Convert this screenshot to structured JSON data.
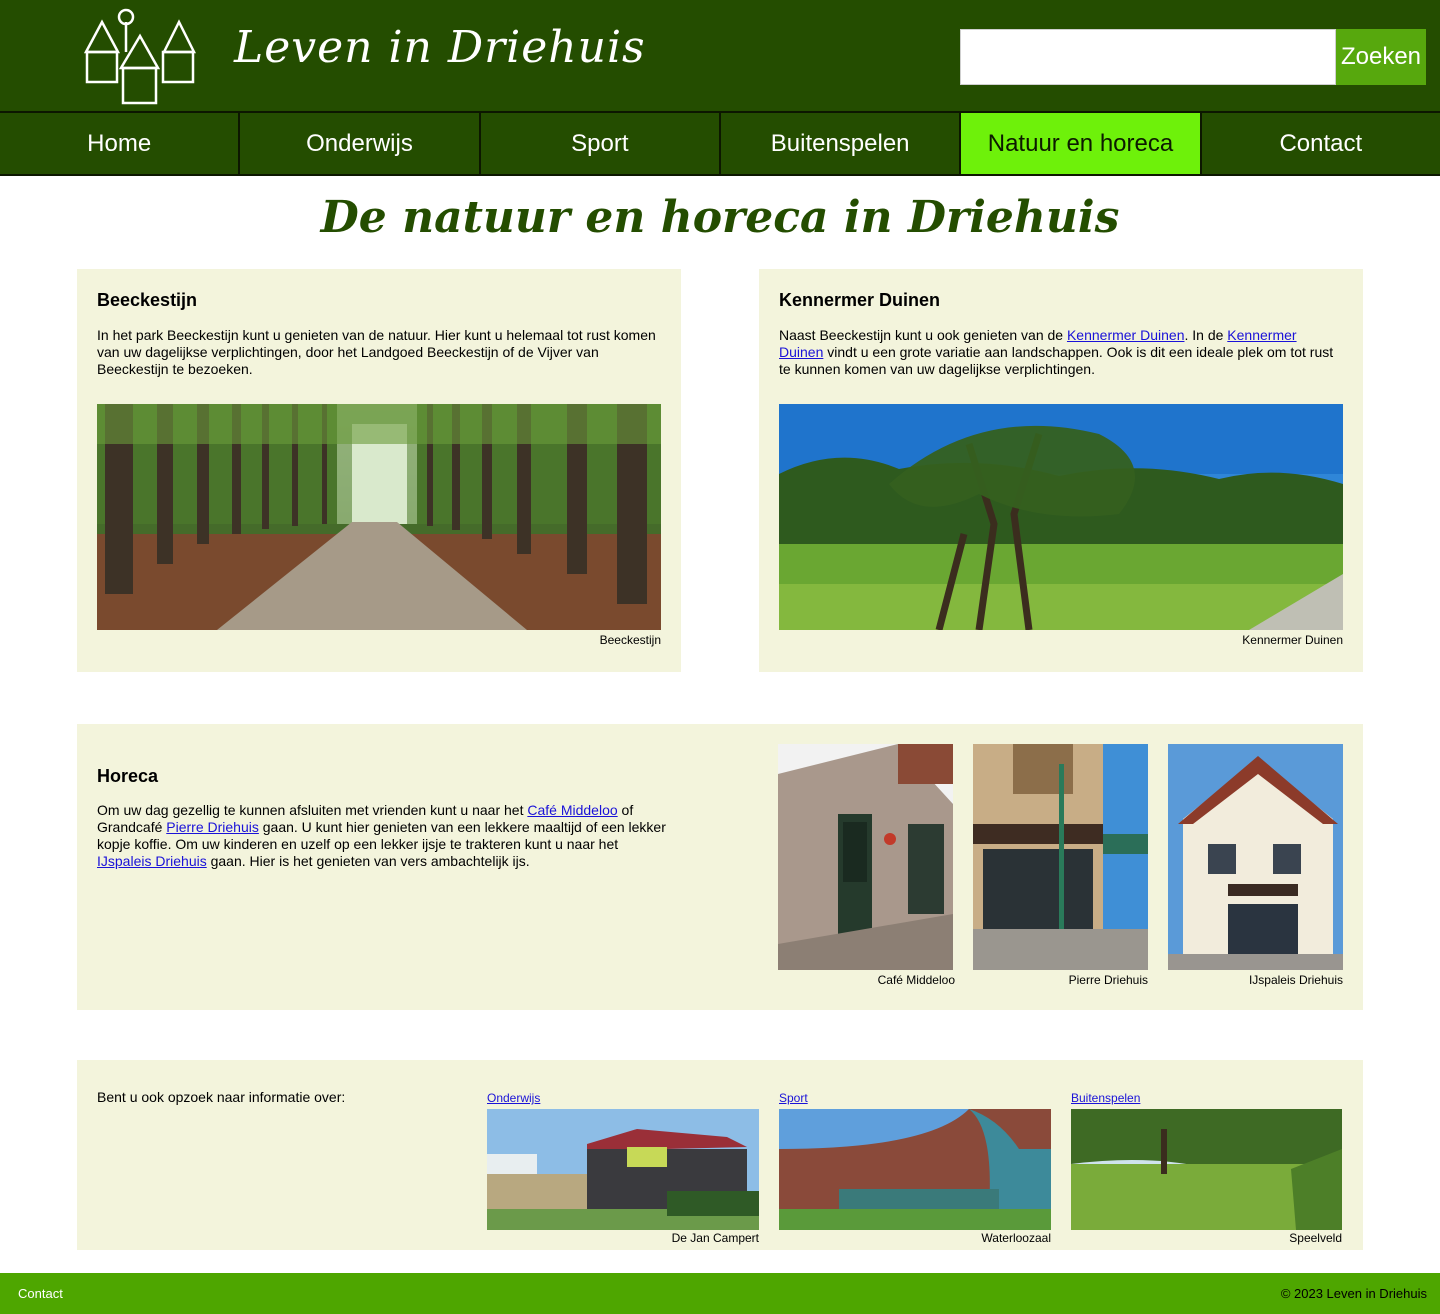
{
  "header": {
    "title": "Leven in Driehuis",
    "search_placeholder": "",
    "search_button": "Zoeken"
  },
  "nav": {
    "items": [
      {
        "label": "Home"
      },
      {
        "label": "Onderwijs"
      },
      {
        "label": "Sport"
      },
      {
        "label": "Buitenspelen"
      },
      {
        "label": "Natuur en horeca",
        "active": true
      },
      {
        "label": "Contact"
      }
    ]
  },
  "page_title": "De natuur en horeca in Driehuis",
  "beeckestijn": {
    "heading": "Beeckestijn",
    "text": "In het park Beeckestijn kunt u genieten van de natuur. Hier kunt u helemaal tot rust komen van uw dagelijkse verplichtingen, door het Landgoed Beeckestijn of de Vijver van Beeckestijn te bezoeken.",
    "caption": "Beeckestijn"
  },
  "kennemer": {
    "heading": "Kennermer Duinen",
    "text_1": "Naast Beeckestijn kunt u ook genieten van de ",
    "link_1": "Kennermer Duinen",
    "text_2": ". In de ",
    "link_2": "Kennermer Duinen",
    "text_3": " vindt u een grote variatie aan landschappen. Ook is dit een ideale plek om tot rust te kunnen komen van uw dagelijkse verplichtingen.",
    "caption": "Kennermer Duinen"
  },
  "horeca": {
    "heading": "Horeca",
    "text_1": "Om uw dag gezellig te kunnen afsluiten met vrienden kunt u naar het ",
    "link_1": "Café Middeloo",
    "text_2": " of Grandcafé ",
    "link_2": "Pierre Driehuis",
    "text_3": " gaan. U kunt hier genieten van een lekkere maaltijd of een lekker kopje koffie. Om uw kinderen en uzelf op een lekker ijsje te trakteren kunt u naar het ",
    "link_3": "IJspaleis Driehuis",
    "text_4": " gaan. Hier is het genieten van vers ambachtelijk ijs.",
    "photos": [
      {
        "caption": "Café Middeloo"
      },
      {
        "caption": "Pierre Driehuis"
      },
      {
        "caption": "IJspaleis Driehuis"
      }
    ]
  },
  "related": {
    "intro": "Bent u ook opzoek naar informatie over:",
    "items": [
      {
        "link": "Onderwijs",
        "caption": "De Jan Campert"
      },
      {
        "link": "Sport",
        "caption": "Waterloozaal"
      },
      {
        "link": "Buitenspelen",
        "caption": "Speelveld"
      }
    ]
  },
  "footer": {
    "contact": "Contact",
    "copyright": "© 2023 Leven in Driehuis"
  },
  "colors": {
    "header_bg": "#244d00",
    "nav_active": "#6ef10a",
    "card_bg": "#f3f4dc",
    "footer_bg": "#4ea600",
    "search_button": "#57a80d"
  }
}
